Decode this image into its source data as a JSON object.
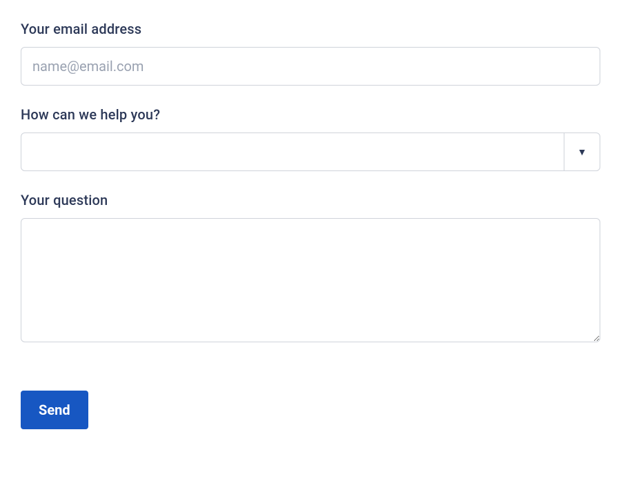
{
  "form": {
    "email": {
      "label": "Your email address",
      "placeholder": "name@email.com",
      "value": ""
    },
    "help_topic": {
      "label": "How can we help you?",
      "value": ""
    },
    "question": {
      "label": "Your question",
      "value": ""
    },
    "submit_label": "Send"
  }
}
